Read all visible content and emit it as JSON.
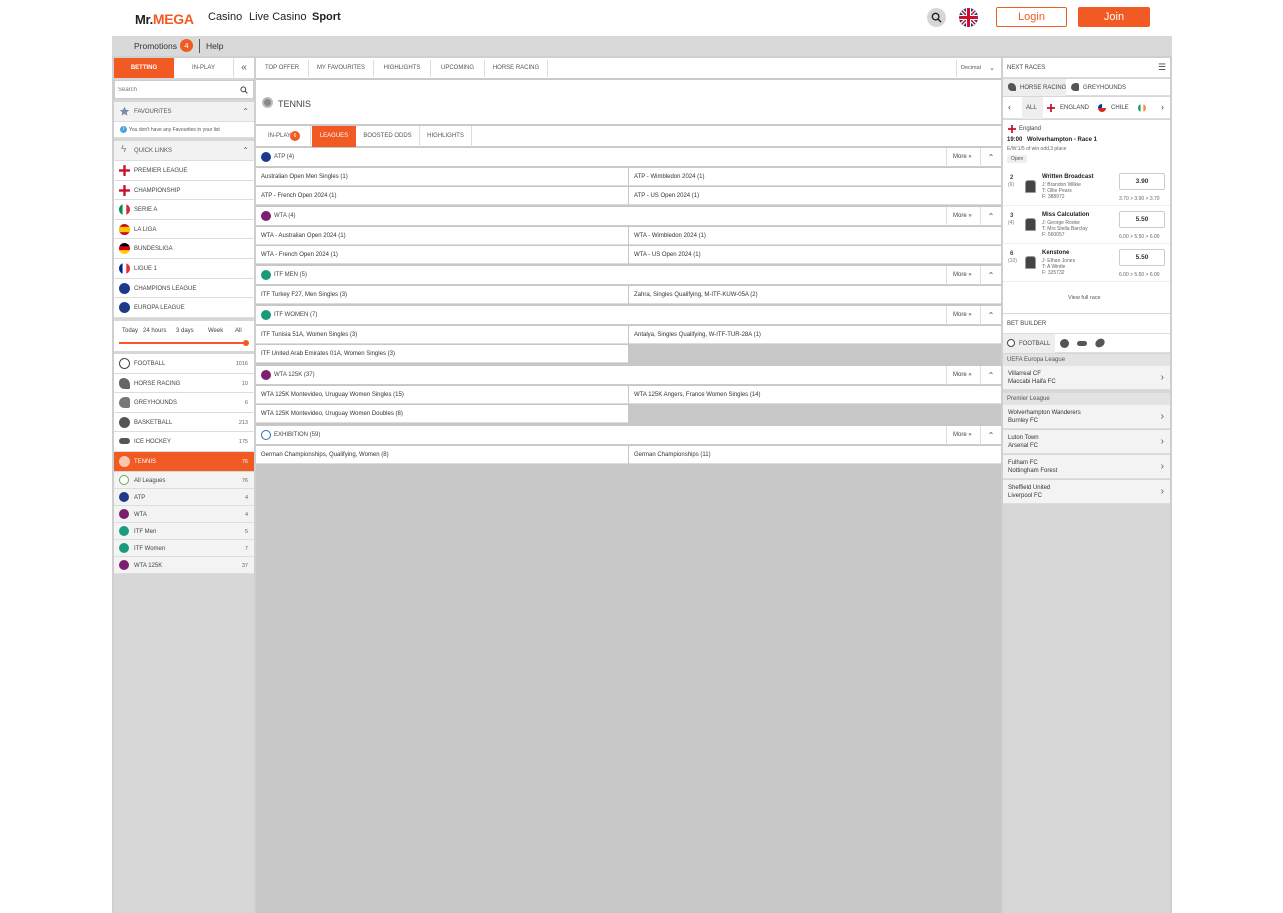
{
  "header": {
    "logo_mr": "Mr.",
    "logo_mega": "MEGA",
    "nav": [
      "Casino",
      "Live Casino",
      "Sport"
    ],
    "login": "Login",
    "join": "Join"
  },
  "subbar": {
    "promotions": "Promotions",
    "promo_count": "4",
    "help": "Help"
  },
  "left": {
    "tabs": {
      "betting": "BETTING",
      "inplay": "IN-PLAY",
      "collapse": "«"
    },
    "search_placeholder": "Search",
    "favourites": {
      "title": "FAVOURITES",
      "empty": "You don't have any Favourites in your list"
    },
    "quick_links": {
      "title": "QUICK LINKS",
      "items": [
        "PREMIER LEAGUE",
        "CHAMPIONSHIP",
        "SERIE A",
        "LA LIGA",
        "BUNDESLIGA",
        "LIGUE 1",
        "CHAMPIONS LEAGUE",
        "EUROPA LEAGUE"
      ]
    },
    "time_filters": [
      "Today",
      "24 hours",
      "3 days",
      "Week",
      "All"
    ],
    "time_filter_level": 1.0,
    "sports": [
      {
        "name": "FOOTBALL",
        "count": "1016"
      },
      {
        "name": "HORSE RACING",
        "count": "10"
      },
      {
        "name": "GREYHOUNDS",
        "count": "6"
      },
      {
        "name": "BASKETBALL",
        "count": "213"
      },
      {
        "name": "ICE HOCKEY",
        "count": "175"
      },
      {
        "name": "TENNIS",
        "count": "76"
      }
    ],
    "leagues": [
      {
        "name": "All Leagues",
        "count": "76"
      },
      {
        "name": "ATP",
        "count": "4"
      },
      {
        "name": "WTA",
        "count": "4"
      },
      {
        "name": "ITF Men",
        "count": "5"
      },
      {
        "name": "ITF Women",
        "count": "7"
      },
      {
        "name": "WTA 125K",
        "count": "37"
      }
    ]
  },
  "mid": {
    "top_tabs": [
      "TOP OFFER",
      "MY FAVOURITES",
      "HIGHLIGHTS",
      "UPCOMING",
      "HORSE RACING"
    ],
    "odds_format": "Decimal",
    "title": "TENNIS",
    "sub_tabs": {
      "inplay": "IN-PLAY",
      "inplay_count": "6",
      "leagues": "LEAGUES",
      "boosted": "BOOSTED ODDS",
      "highlights": "HIGHLIGHTS"
    },
    "more": "More",
    "groups": [
      {
        "title": "ATP (4)",
        "color": "#1d3a8a",
        "items": [
          "Australian Open Men Singles  (1)",
          "ATP - Wimbledon 2024  (1)",
          "ATP - French Open 2024  (1)",
          "ATP - US Open 2024  (1)"
        ]
      },
      {
        "title": "WTA (4)",
        "color": "#7b1f6e",
        "items": [
          "WTA - Australian Open 2024  (1)",
          "WTA - Wimbledon 2024  (1)",
          "WTA - French Open 2024  (1)",
          "WTA - US Open 2024  (1)"
        ]
      },
      {
        "title": "ITF MEN (5)",
        "color": "#1a9c7b",
        "items": [
          "ITF Turkey F27, Men Singles  (3)",
          "Zahra, Singles Qualifying, M-ITF-KUW-05A  (2)"
        ]
      },
      {
        "title": "ITF WOMEN (7)",
        "color": "#1a9c7b",
        "items": [
          "ITF Tunisia 51A, Women Singles  (3)",
          "Antalya, Singles Qualifying, W-ITF-TUR-28A  (1)",
          "ITF United Arab Emirates 01A, Women Singles  (3)"
        ]
      },
      {
        "title": "WTA 125K (37)",
        "color": "#7b1f6e",
        "items": [
          "WTA 125K Montevideo, Uruguay Women Singles  (15)",
          "WTA 125K Angers, France Women Singles  (14)",
          "WTA 125K Montevideo, Uruguay Women Doubles  (8)"
        ]
      },
      {
        "title": "EXHIBITION (59)",
        "color": "#2f6fb0",
        "items": [
          "German Championships, Qualifying, Women  (8)",
          "German Championships  (11)"
        ]
      }
    ]
  },
  "right": {
    "next_races": "NEXT RACES",
    "race_tabs": [
      "HORSE RACING",
      "GREYHOUNDS"
    ],
    "filters": [
      "ALL",
      "ENGLAND",
      "CHILE"
    ],
    "race": {
      "country": "England",
      "time": "19:00",
      "name": "Wolverhampton - Race 1",
      "terms": "E/W:1/5 of win odd,3 place",
      "status": "Open"
    },
    "runners": [
      {
        "num": "2",
        "draw": "(6)",
        "name": "Written Broadcast",
        "jockey": "J: Brandon Wilkie",
        "trainer": "T: Ollie Pears",
        "form": "F: 388972",
        "odds": "3.90",
        "history": "3.70 > 3.90 > 3.70"
      },
      {
        "num": "3",
        "draw": "(4)",
        "name": "Miss Calculation",
        "jockey": "J: George Rooke",
        "trainer": "T: Mrs Stella Barclay",
        "form": "F: 560057",
        "odds": "5.50",
        "history": "6.00 > 5.50 > 6.00"
      },
      {
        "num": "6",
        "draw": "(10)",
        "name": "Kenstone",
        "jockey": "J: Ethan Jones",
        "trainer": "T: A Wintle",
        "form": "F: 325732",
        "odds": "5.50",
        "history": "6.00 > 5.50 > 6.00"
      }
    ],
    "view_full": "View full race",
    "bet_builder": "BET BUILDER",
    "bb_sport": "FOOTBALL",
    "competitions": [
      {
        "name": "UEFA Europa League",
        "matches": [
          [
            "Villarreal CF",
            "Maccabi Haifa FC"
          ]
        ]
      },
      {
        "name": "Premier League",
        "matches": [
          [
            "Wolverhampton Wanderers",
            "Burnley FC"
          ],
          [
            "Luton Town",
            "Arsenal FC"
          ],
          [
            "Fulham FC",
            "Nottingham Forest"
          ],
          [
            "Sheffield United",
            "Liverpool FC"
          ]
        ]
      }
    ]
  },
  "colors": {
    "accent": "#f15a22"
  }
}
